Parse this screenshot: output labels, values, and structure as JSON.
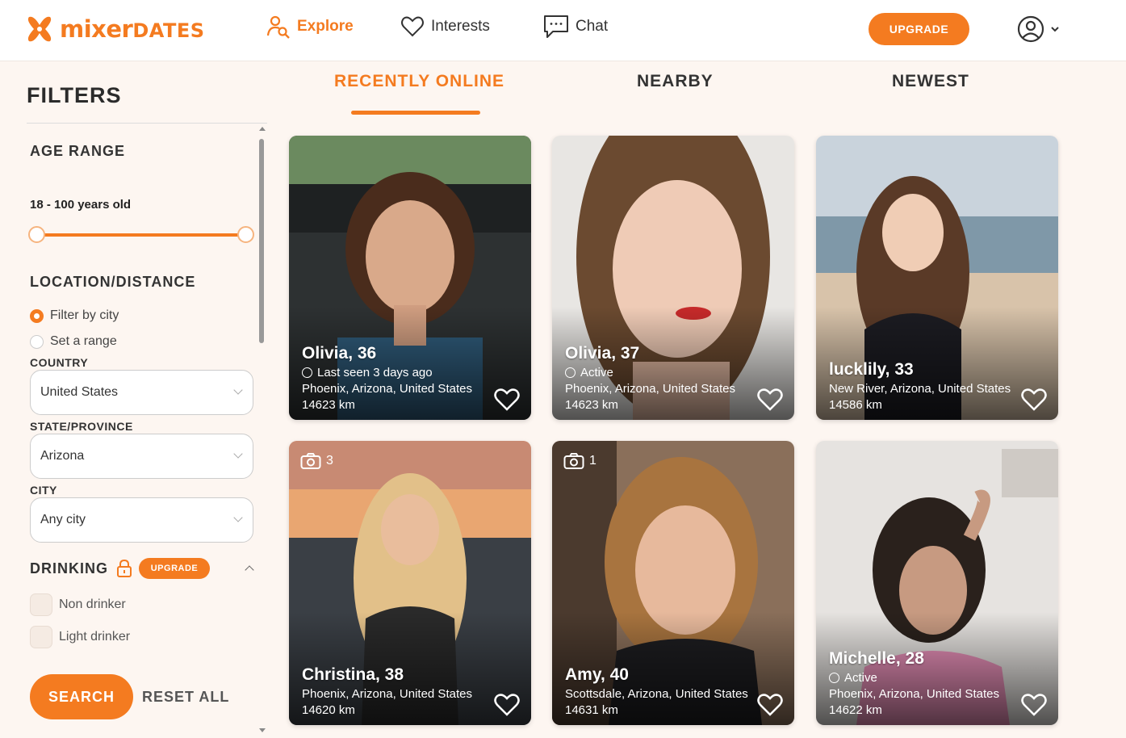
{
  "brand": {
    "name_part1": "mixer",
    "name_part2": "DATES",
    "accent": "#f47b20"
  },
  "nav": {
    "explore": "Explore",
    "interests": "Interests",
    "chat": "Chat",
    "upgrade": "UPGRADE"
  },
  "filters": {
    "title": "FILTERS",
    "age_range_title": "AGE RANGE",
    "age_range_value": "18 - 100 years old",
    "location_title": "LOCATION/DISTANCE",
    "option_city": "Filter by city",
    "option_range": "Set a range",
    "country_label": "COUNTRY",
    "country_value": "United States",
    "state_label": "STATE/PROVINCE",
    "state_value": "Arizona",
    "city_label": "CITY",
    "city_value": "Any city",
    "drinking_title": "DRINKING",
    "drinking_badge": "UPGRADE",
    "drink_options": [
      "Non drinker",
      "Light drinker"
    ],
    "search": "SEARCH",
    "reset": "RESET ALL"
  },
  "tabs": [
    "RECENTLY ONLINE",
    "NEARBY",
    "NEWEST"
  ],
  "profiles": [
    {
      "name": "Olivia, 36",
      "status": "Last seen 3 days ago",
      "location": "Phoenix, Arizona, United States",
      "distance": "14623 km",
      "photos": ""
    },
    {
      "name": "Olivia, 37",
      "status": "Active",
      "location": "Phoenix, Arizona, United States",
      "distance": "14623 km",
      "photos": ""
    },
    {
      "name": "lucklily, 33",
      "status": "",
      "location": "New River, Arizona, United States",
      "distance": "14586 km",
      "photos": ""
    },
    {
      "name": "Christina, 38",
      "status": "",
      "location": "Phoenix, Arizona, United States",
      "distance": "14620 km",
      "photos": "3"
    },
    {
      "name": "Amy, 40",
      "status": "",
      "location": "Scottsdale, Arizona, United States",
      "distance": "14631 km",
      "photos": "1"
    },
    {
      "name": "Michelle, 28",
      "status": "Active",
      "location": "Phoenix, Arizona, United States",
      "distance": "14622 km",
      "photos": ""
    }
  ]
}
